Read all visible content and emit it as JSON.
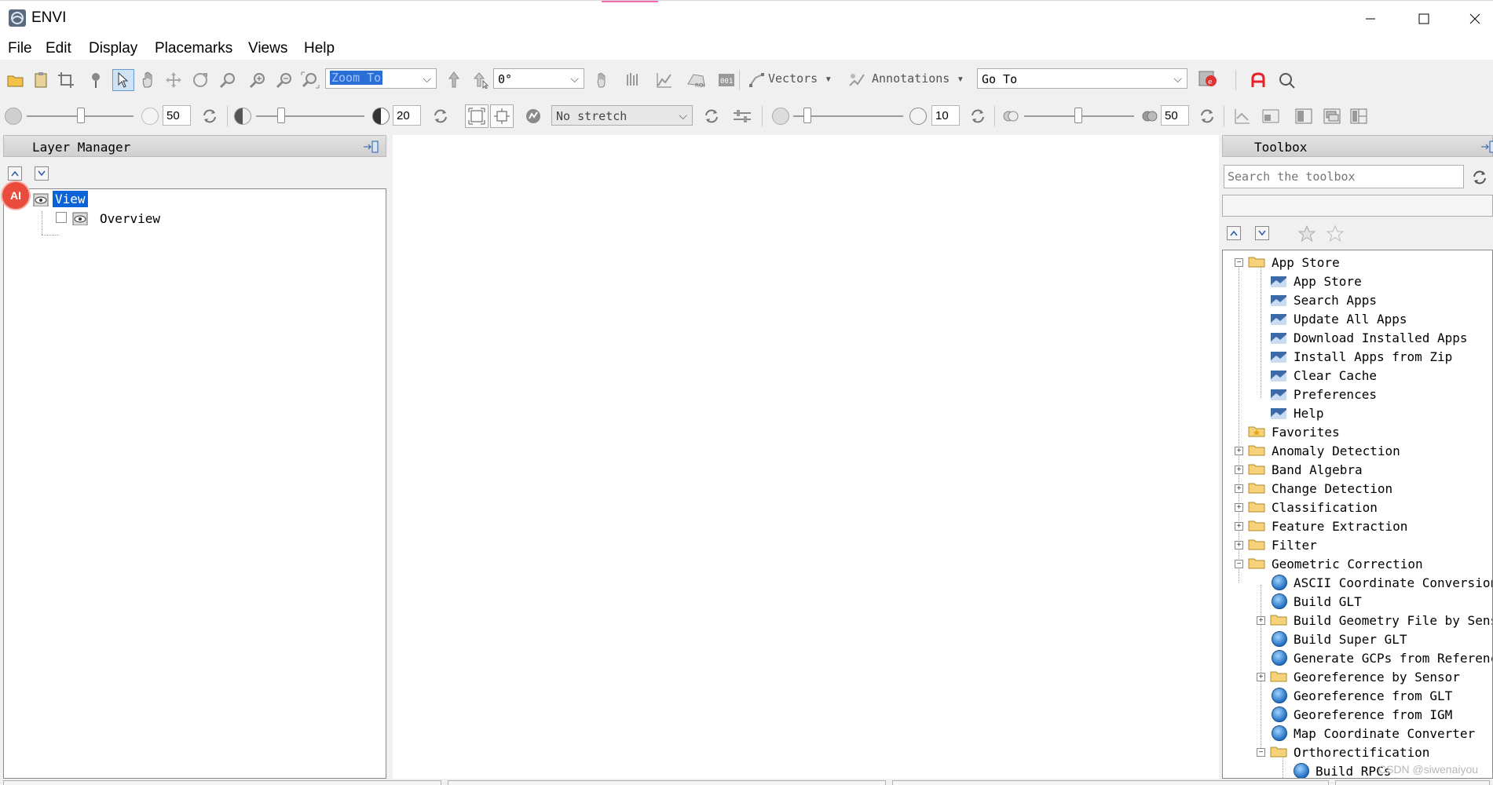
{
  "window": {
    "title": "ENVI",
    "minimize": "—",
    "maximize": "☐",
    "close": "✕"
  },
  "menu": {
    "items": [
      "File",
      "Edit",
      "Display",
      "Placemarks",
      "Views",
      "Help"
    ]
  },
  "toolbar1": {
    "zoom_combo_value": "Zoom To",
    "rotation_value": "0°",
    "vectors_label": "Vectors",
    "annotations_label": "Annotations",
    "goto_value": "Go To"
  },
  "toolbar2": {
    "brightness_value": "50",
    "contrast_value": "20",
    "stretch_value": "No stretch",
    "sharpen_value": "10",
    "transparency_value": "50"
  },
  "layer_manager": {
    "title": "Layer Manager",
    "root_label": "View",
    "child_label": "Overview"
  },
  "toolbox": {
    "title": "Toolbox",
    "search_placeholder": "Search the toolbox",
    "tree": [
      {
        "label": "App Store",
        "level": 0,
        "type": "folder",
        "expanded": true
      },
      {
        "label": "App Store",
        "level": 1,
        "type": "app"
      },
      {
        "label": "Search Apps",
        "level": 1,
        "type": "app"
      },
      {
        "label": "Update All Apps",
        "level": 1,
        "type": "app"
      },
      {
        "label": "Download Installed Apps",
        "level": 1,
        "type": "app"
      },
      {
        "label": "Install Apps from Zip",
        "level": 1,
        "type": "app"
      },
      {
        "label": "Clear Cache",
        "level": 1,
        "type": "app"
      },
      {
        "label": "Preferences",
        "level": 1,
        "type": "app"
      },
      {
        "label": "Help",
        "level": 1,
        "type": "app"
      },
      {
        "label": "Favorites",
        "level": 0,
        "type": "favorites"
      },
      {
        "label": "Anomaly Detection",
        "level": 0,
        "type": "folder",
        "expanded": false
      },
      {
        "label": "Band Algebra",
        "level": 0,
        "type": "folder",
        "expanded": false
      },
      {
        "label": "Change Detection",
        "level": 0,
        "type": "folder",
        "expanded": false
      },
      {
        "label": "Classification",
        "level": 0,
        "type": "folder",
        "expanded": false
      },
      {
        "label": "Feature Extraction",
        "level": 0,
        "type": "folder",
        "expanded": false
      },
      {
        "label": "Filter",
        "level": 0,
        "type": "folder",
        "expanded": false
      },
      {
        "label": "Geometric Correction",
        "level": 0,
        "type": "folder",
        "expanded": true
      },
      {
        "label": "ASCII Coordinate Conversion",
        "level": 1,
        "type": "tool"
      },
      {
        "label": "Build GLT",
        "level": 1,
        "type": "tool"
      },
      {
        "label": "Build Geometry File by Sensor",
        "level": 1,
        "type": "folder",
        "expanded": false
      },
      {
        "label": "Build Super GLT",
        "level": 1,
        "type": "tool"
      },
      {
        "label": "Generate GCPs from Reference",
        "level": 1,
        "type": "tool"
      },
      {
        "label": "Georeference by Sensor",
        "level": 1,
        "type": "folder",
        "expanded": false
      },
      {
        "label": "Georeference from GLT",
        "level": 1,
        "type": "tool"
      },
      {
        "label": "Georeference from IGM",
        "level": 1,
        "type": "tool"
      },
      {
        "label": "Map Coordinate Converter",
        "level": 1,
        "type": "tool"
      },
      {
        "label": "Orthorectification",
        "level": 1,
        "type": "folder",
        "expanded": true
      },
      {
        "label": "Build RPCs",
        "level": 2,
        "type": "tool"
      }
    ]
  },
  "overlay": {
    "ai_badge": "AI",
    "watermark": "CSDN @siwenaiyou"
  }
}
